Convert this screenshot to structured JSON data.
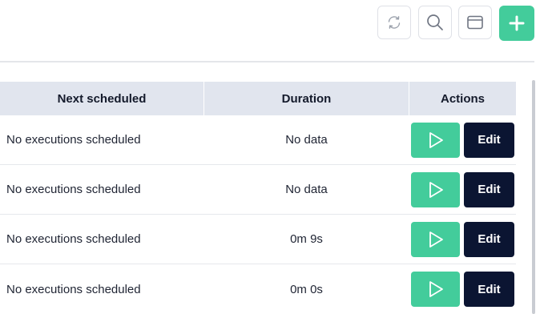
{
  "toolbar": {
    "refresh_icon": "refresh-icon",
    "search_icon": "search-icon",
    "window_icon": "window-icon",
    "add_icon": "plus-icon",
    "accent_color": "#43cc9b"
  },
  "table": {
    "columns": [
      "Next scheduled",
      "Duration",
      "Actions"
    ],
    "rows": [
      {
        "next_scheduled": "No executions scheduled",
        "duration": "No data",
        "edit_label": "Edit"
      },
      {
        "next_scheduled": "No executions scheduled",
        "duration": "No data",
        "edit_label": "Edit"
      },
      {
        "next_scheduled": "No executions scheduled",
        "duration": "0m 9s",
        "edit_label": "Edit"
      },
      {
        "next_scheduled": "No executions scheduled",
        "duration": "0m 0s",
        "edit_label": "Edit"
      }
    ],
    "run_icon": "play-icon",
    "run_color": "#43cc9b",
    "edit_color": "#0b1532",
    "header_color": "#e1e5ee"
  }
}
